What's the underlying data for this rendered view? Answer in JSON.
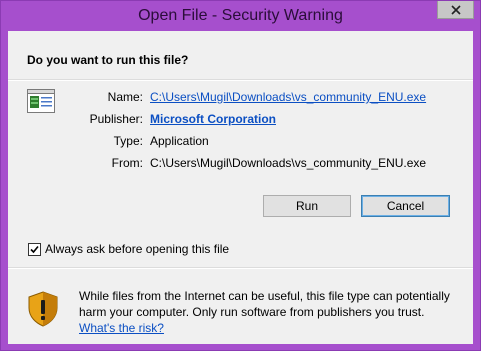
{
  "window": {
    "title": "Open File - Security Warning",
    "close_icon": "close-icon",
    "frame_color": "#a64fcd"
  },
  "dialog": {
    "question": "Do you want to run this file?",
    "file_icon": "file-icon",
    "fields": {
      "name_label": "Name:",
      "name_value": "C:\\Users\\Mugil\\Downloads\\vs_community_ENU.exe",
      "publisher_label": "Publisher:",
      "publisher_value": "Microsoft Corporation",
      "type_label": "Type:",
      "type_value": "Application",
      "from_label": "From:",
      "from_value": "C:\\Users\\Mugil\\Downloads\\vs_community_ENU.exe"
    },
    "buttons": {
      "run_label": "Run",
      "cancel_label": "Cancel"
    },
    "checkbox": {
      "label": "Always ask before opening this file",
      "checked": true
    },
    "warning": {
      "icon": "shield-warning-icon",
      "text": "While files from the Internet can be useful, this file type can potentially harm your computer. Only run software from publishers you trust.",
      "link_label": "What's the risk?"
    }
  }
}
